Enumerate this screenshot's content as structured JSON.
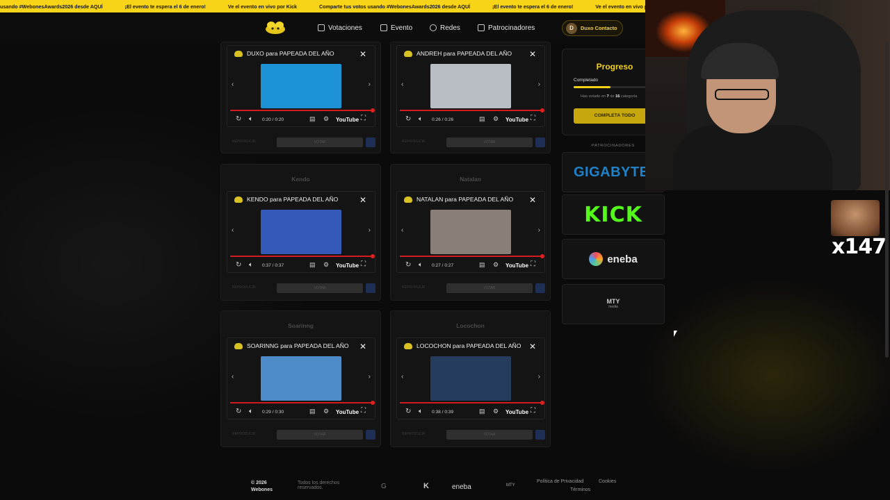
{
  "ticker": [
    "usando #WebonesAwards2026 desde AQUÍ",
    "¡El evento te espera el 6 de enero!",
    "Ve el evento en vivo por Kick",
    "Comparte tus votos usando #WebonesAwards2026 desde AQUÍ",
    "¡El evento te espera el 6 de enero!",
    "Ve el evento en vivo por"
  ],
  "nav": {
    "items": [
      "Votaciones",
      "Evento",
      "Redes",
      "Patrocinadores"
    ],
    "user_initial": "D",
    "user_label": "Duxo Contacto"
  },
  "nominees": [
    {
      "name": "",
      "video_title": "DUXO para PAPEADA DEL AÑO",
      "time": "0:20 / 0:20",
      "thumb": "#1d93d6"
    },
    {
      "name": "",
      "video_title": "ANDREH para PAPEADA DEL AÑO",
      "time": "0:26 / 0:26",
      "thumb": "#b9bdc4"
    },
    {
      "name": "Kendo",
      "video_title": "KENDO para PAPEADA DEL AÑO",
      "time": "0:37 / 0:37",
      "thumb": "#3559b8"
    },
    {
      "name": "Natalan",
      "video_title": "NATALAN para PAPEADA DEL AÑO",
      "time": "0:27 / 0:27",
      "thumb": "#8a7f78"
    },
    {
      "name": "Soarinng",
      "video_title": "SOARINNG para PAPEADA DEL AÑO",
      "time": "0:29 / 0:30",
      "thumb": "#4d8cc8"
    },
    {
      "name": "Locochon",
      "video_title": "LOCOCHON para PAPEADA DEL AÑO",
      "time": "0:38 / 0:39",
      "thumb": "#263c5c"
    }
  ],
  "player": {
    "youtube": "YouTube",
    "reproduce": "REPRODUCIR",
    "vote": "VOTAR"
  },
  "progress": {
    "title": "Progreso",
    "completed_label": "Completado",
    "voted_prefix": "Has votado en",
    "voted_count": "7",
    "voted_middle": "de",
    "total": "16",
    "voted_suffix": "categoría",
    "fraction": 0.44,
    "cta": "COMPLETA TODO"
  },
  "sponsors": {
    "heading": "PATROCINADORES",
    "items": [
      "GIGABYTE",
      "KICK",
      "eneba",
      "MTY"
    ],
    "mty_sub": "media"
  },
  "overlay": {
    "emote_count": "x147"
  },
  "footer": {
    "copyright": "© 2026",
    "brand": "Webones",
    "rights": "Todos los derechos reservados.",
    "eneba": "eneba",
    "privacy": "Política de Privacidad",
    "cookies": "Cookies",
    "terms": "Términos"
  },
  "colors": {
    "accent": "#f7d417",
    "kick": "#53fc18",
    "gigabyte": "#1f82c8",
    "progress_red": "#d51b1b"
  }
}
